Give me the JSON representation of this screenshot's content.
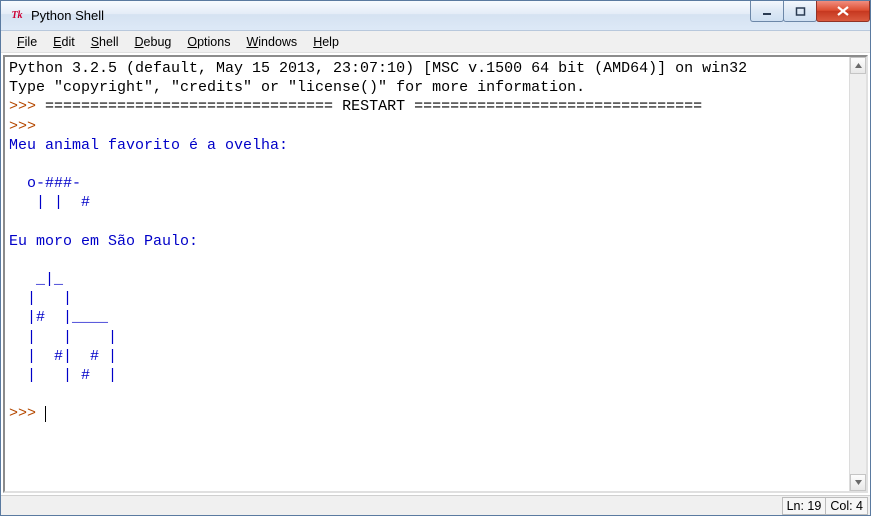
{
  "window": {
    "title": "Python Shell",
    "icon_label": "Tk"
  },
  "menu": {
    "file": "File",
    "edit": "Edit",
    "shell": "Shell",
    "debug": "Debug",
    "options": "Options",
    "windows": "Windows",
    "help": "Help"
  },
  "shell": {
    "banner1": "Python 3.2.5 (default, May 15 2013, 23:07:10) [MSC v.1500 64 bit (AMD64)] on win32",
    "banner2": "Type \"copyright\", \"credits\" or \"license()\" for more information.",
    "prompt": ">>> ",
    "restart_line": "================================ RESTART ================================",
    "out1": "Meu animal favorito é a ovelha:",
    "blank": "",
    "art1a": "  o-###-",
    "art1b": "   | |  #",
    "out2": "Eu moro em São Paulo:",
    "art2a": "   _|_",
    "art2b": "  |   |",
    "art2c": "  |#  |____",
    "art2d": "  |   |    |",
    "art2e": "  |  #|  # |",
    "art2f": "  |   | #  |"
  },
  "status": {
    "line": "Ln: 19",
    "col": "Col: 4"
  }
}
